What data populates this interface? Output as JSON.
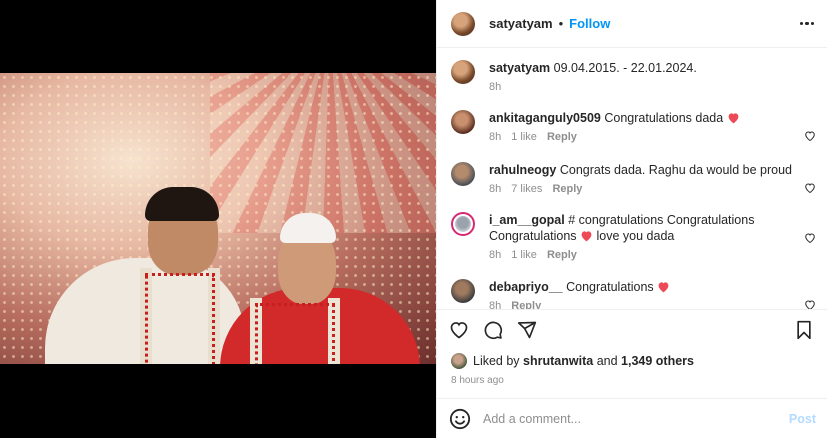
{
  "header": {
    "username": "satyatyam",
    "separator": "•",
    "follow_label": "Follow"
  },
  "caption": {
    "username": "satyatyam",
    "text": "09.04.2015. - 22.01.2024.",
    "time": "8h"
  },
  "comments": [
    {
      "username": "ankitaganguly0509",
      "text": "Congratulations dada",
      "has_heart": true,
      "time": "8h",
      "likes": "1 like",
      "reply": "Reply"
    },
    {
      "username": "rahulneogy",
      "text": "Congrats dada. Raghu da would be proud",
      "has_heart": false,
      "time": "8h",
      "likes": "7 likes",
      "reply": "Reply"
    },
    {
      "username": "i_am__gopal",
      "text": "# congratulations Congratulations",
      "text2_pre": "Congratulations",
      "text2_post": "love you dada",
      "has_heart": true,
      "time": "8h",
      "likes": "1 like",
      "reply": "Reply"
    },
    {
      "username": "debapriyo__",
      "text": "Congratulations",
      "has_heart": true,
      "time": "8h",
      "likes": "",
      "reply": "Reply"
    }
  ],
  "likes": {
    "prefix": "Liked by",
    "user": "shrutanwita",
    "and": "and",
    "count": "1,349 others"
  },
  "time_ago": "8 hours ago",
  "comment_input": {
    "placeholder": "Add a comment...",
    "post_label": "Post"
  },
  "colors": {
    "follow": "#0095f6",
    "heart": "#ed4956",
    "muted": "#8e8e8e"
  }
}
